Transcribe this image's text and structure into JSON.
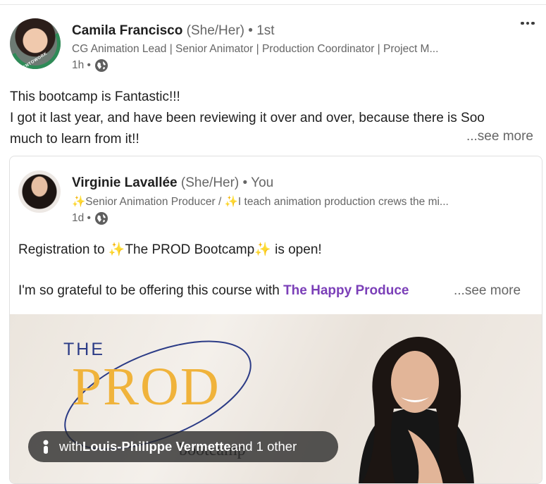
{
  "post": {
    "author": {
      "name": "Camila Francisco",
      "pronouns": "(She/Her)",
      "degree": "• 1st",
      "headline": "CG Animation Lead | Senior Animator | Production Coordinator | Project M...",
      "time": "1h •",
      "badge": "#OPENTOWORK"
    },
    "text_lines": [
      "This bootcamp is Fantastic!!!",
      "I got it last year, and have been reviewing it over and over, because there is Soo",
      "much to learn from it!!"
    ],
    "see_more": "...see more"
  },
  "shared": {
    "author": {
      "name": "Virginie Lavallée",
      "pronouns": "(She/Her)",
      "degree": "• You",
      "headline": "✨Senior Animation Producer / ✨I teach animation production crews the mi...",
      "time": "1d •"
    },
    "text_line1": "Registration to ✨The PROD Bootcamp✨ is open!",
    "text_line2_prefix": "I'm so grateful to be offering this course with ",
    "link_text": "The Happy Produce",
    "see_more": "...see more",
    "image": {
      "the": "THE",
      "prod": "PROD",
      "sub": "bootcamp"
    },
    "tag": {
      "prefix": "with ",
      "person": "Louis-Philippe Vermette",
      "suffix": " and 1 other"
    }
  },
  "colors": {
    "link": "#7b3fb8",
    "prod_gold": "#f0b33b",
    "the_navy": "#2b3b86",
    "open_to_work_green": "#2e8b57"
  },
  "icons": {
    "globe": "globe-icon",
    "more": "more-options-icon",
    "person": "person-icon"
  }
}
